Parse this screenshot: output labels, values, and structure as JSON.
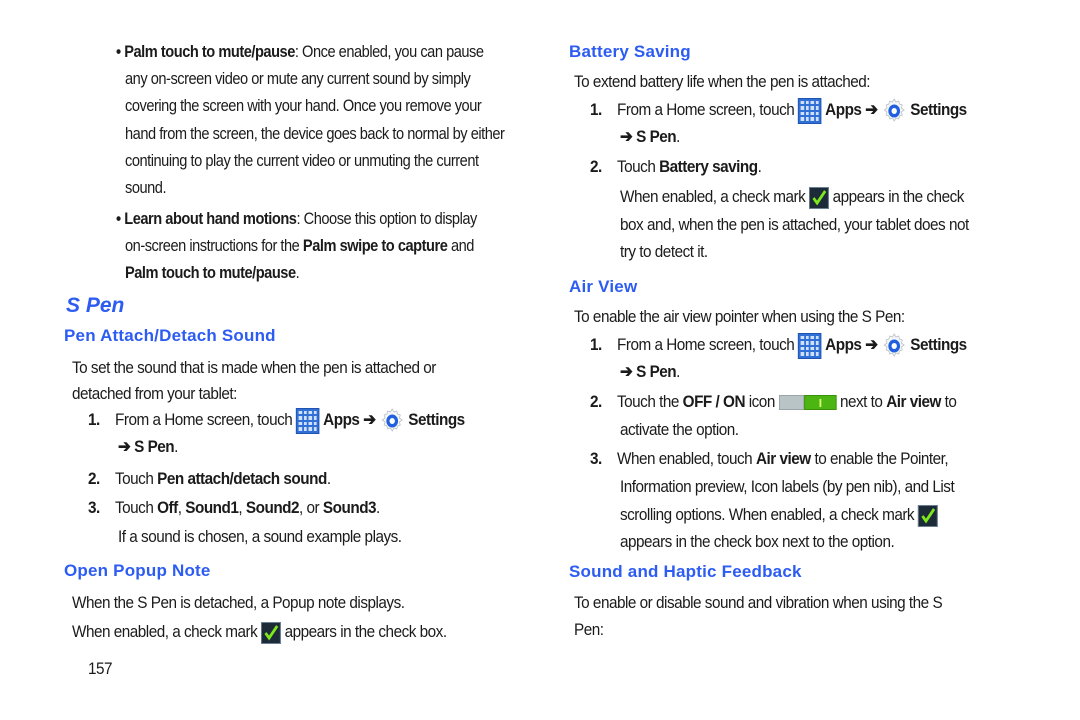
{
  "page_number": "157",
  "colors": {
    "heading": "#2d5cf2",
    "text": "#1b1b1b"
  },
  "icons": {
    "apps": "apps-grid-icon",
    "settings": "settings-gear-icon",
    "check": "checkmark-icon",
    "toggle": "off-on-toggle-icon",
    "arrow": "➔"
  },
  "left": {
    "bullet1": {
      "term": "Palm touch to mute/pause",
      "lines": [
        ": Once enabled, you can pause",
        "any on-screen video or mute any current sound by simply",
        "covering the screen with your hand. Once you remove your",
        "hand from the screen, the device goes back to normal by either",
        "continuing to play the current video or unmuting the current",
        "sound."
      ]
    },
    "bullet2": {
      "term": "Learn about hand motions",
      "line1_rest": ": Choose this option to display",
      "line2_pre": "on-screen instructions for the ",
      "line2_bold": "Palm swipe to capture",
      "line2_post": " and",
      "line3_bold": "Palm touch to mute/pause",
      "line3_post": "."
    },
    "section_title": "S Pen",
    "pen_attach": {
      "heading": "Pen Attach/Detach Sound",
      "intro_line1": "To set the sound that is made when the pen is attached or",
      "intro_line2": "detached from your tablet:",
      "step1": {
        "num": "1.",
        "pre": "From a Home screen, touch ",
        "apps": "Apps",
        "arrow": "➔",
        "settings": "Settings",
        "line2_arrow": "➔",
        "line2_bold": "S Pen",
        "line2_post": "."
      },
      "step2": {
        "num": "2.",
        "pre": "Touch ",
        "bold": "Pen attach/detach sound",
        "post": "."
      },
      "step3": {
        "num": "3.",
        "pre": "Touch ",
        "b1": "Off",
        "s1": ", ",
        "b2": "Sound1",
        "s2": ", ",
        "b3": "Sound2",
        "s3": ", or ",
        "b4": "Sound3",
        "post": "."
      },
      "note": "If a sound is chosen, a sound example plays."
    },
    "popup_note": {
      "heading": "Open Popup Note",
      "line1": "When the S Pen is detached, a Popup note displays.",
      "line2_pre": "When enabled, a check mark ",
      "line2_post": " appears in the check box."
    }
  },
  "right": {
    "battery": {
      "heading": "Battery Saving",
      "intro": "To extend battery life when the pen is attached:",
      "step1": {
        "num": "1.",
        "pre": "From a Home screen, touch ",
        "apps": "Apps",
        "arrow": "➔",
        "settings": "Settings",
        "line2_arrow": "➔",
        "line2_bold": "S Pen",
        "line2_post": "."
      },
      "step2": {
        "num": "2.",
        "pre": "Touch ",
        "bold": "Battery saving",
        "post": "."
      },
      "note_line1_pre": "When enabled, a check mark ",
      "note_line1_post": " appears in the check",
      "note_line2": "box and, when the pen is attached, your tablet does not",
      "note_line3": "try to detect it."
    },
    "air_view": {
      "heading": "Air View",
      "intro": "To enable the air view pointer when using the S Pen:",
      "step1": {
        "num": "1.",
        "pre": "From a Home screen, touch ",
        "apps": "Apps",
        "arrow": "➔",
        "settings": "Settings",
        "line2_arrow": "➔",
        "line2_bold": "S Pen",
        "line2_post": "."
      },
      "step2": {
        "num": "2.",
        "pre": "Touch the ",
        "bold1": "OFF / ON",
        "mid": " icon ",
        "post_pre": " next to ",
        "bold2": "Air view",
        "post": " to",
        "line2": "activate the option."
      },
      "step3": {
        "num": "3.",
        "pre": "When enabled, touch ",
        "bold": "Air view",
        "post": " to enable the Pointer,",
        "line2": "Information preview, Icon labels (by pen nib), and List",
        "line3": "scrolling options. When enabled, a check mark ",
        "line4": "appears in the check box next to the option."
      }
    },
    "haptic": {
      "heading": "Sound and Haptic Feedback",
      "line1": "To enable or disable sound and vibration when using the S",
      "line2": "Pen:"
    }
  }
}
